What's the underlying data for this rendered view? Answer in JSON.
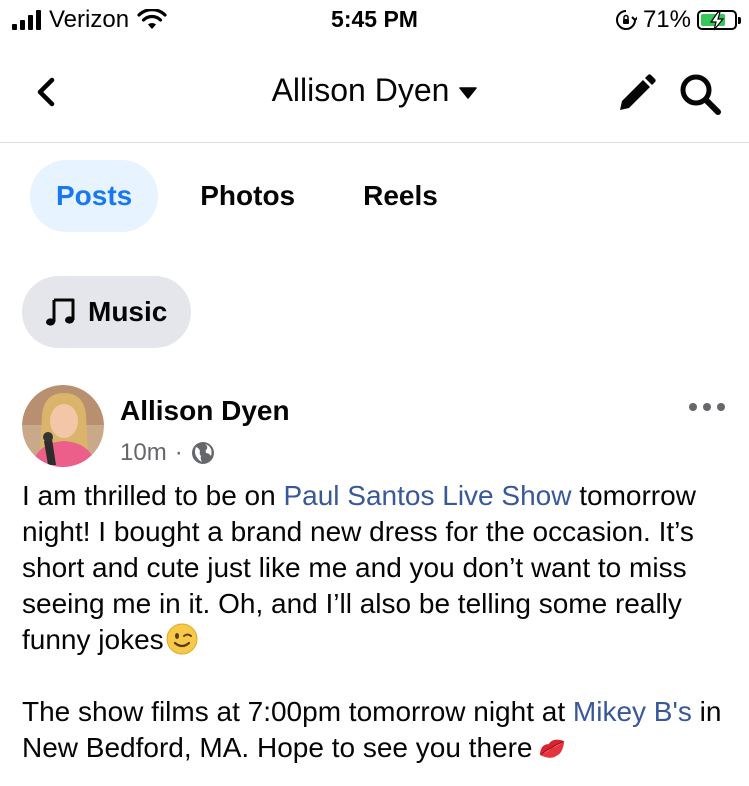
{
  "status_bar": {
    "carrier": "Verizon",
    "time": "5:45 PM",
    "battery_percent": "71%"
  },
  "nav": {
    "title": "Allison Dyen",
    "icons": [
      "back-chevron-icon",
      "caret-down-icon",
      "pencil-icon",
      "search-icon"
    ]
  },
  "tabs": [
    {
      "label": "Posts",
      "active": true
    },
    {
      "label": "Photos",
      "active": false
    },
    {
      "label": "Reels",
      "active": false
    }
  ],
  "filter_chip": {
    "label": "Music",
    "icon": "music-note-icon"
  },
  "post": {
    "author": "Allison Dyen",
    "time": "10m",
    "separator": "·",
    "audience_icon": "globe-icon",
    "text": {
      "p1_a": "I am thrilled to be on ",
      "p1_link": "Paul Santos Live Show",
      "p1_b": " tomorrow night!  I bought a brand new dress for the occasion.  It’s short and cute just like me and you don’t want to miss seeing me in it.  Oh, and I’ll also be telling some really funny jokes",
      "p2_a": "The show films at 7:00pm tomorrow night at ",
      "p2_link": "Mikey B's",
      "p2_b": " in New Bedford, MA.  Hope to see you there"
    },
    "emojis": [
      "winking-face-emoji",
      "kiss-mark-emoji"
    ]
  },
  "colors": {
    "accent": "#1877f2",
    "link": "#385898",
    "tab_active_bg": "#e7f3ff",
    "chip_bg": "#e4e6eb",
    "secondary_text": "#65676b",
    "battery_fill": "#35c759"
  }
}
